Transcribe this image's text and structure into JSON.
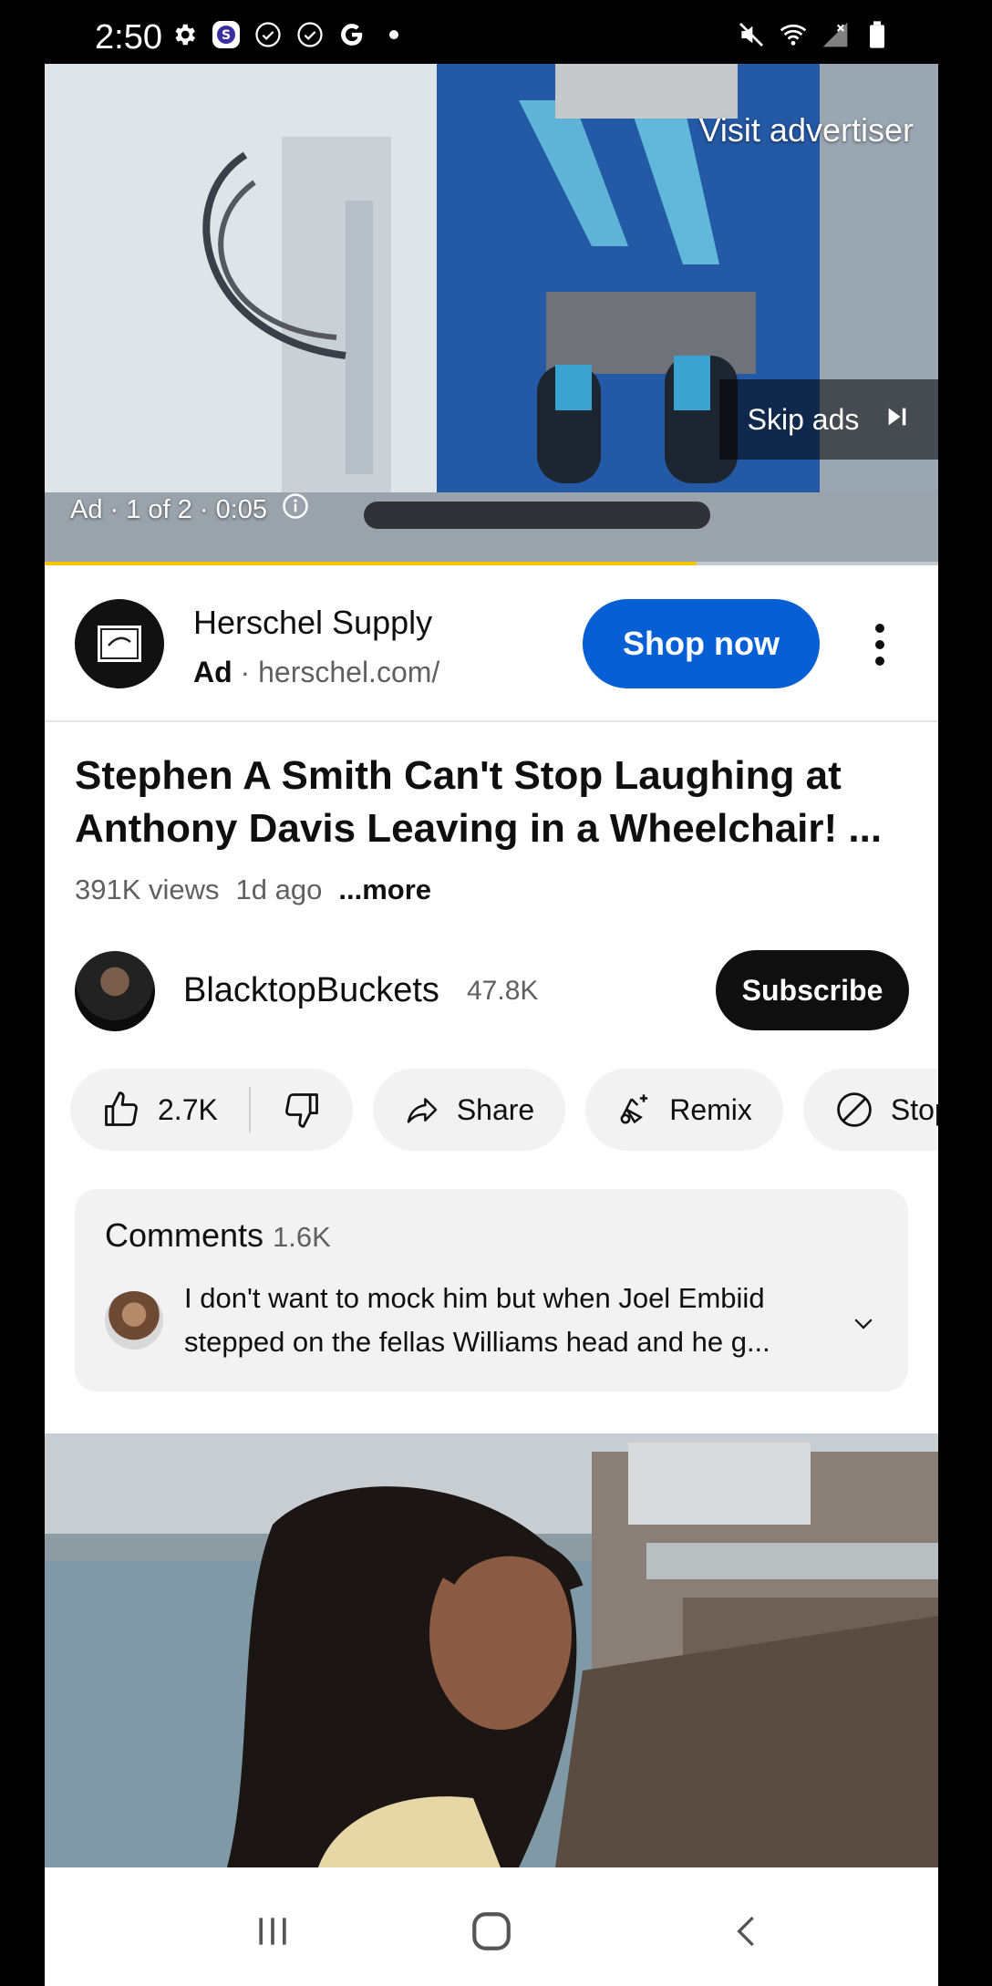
{
  "status_bar": {
    "time": "2:50",
    "left_icons": [
      "gear-icon",
      "app-s-icon",
      "check-circle-icon",
      "check-circle-icon",
      "google-g-icon",
      "dot-icon"
    ],
    "right_icons": [
      "mute-icon",
      "wifi-icon",
      "signal-icon",
      "battery-icon"
    ]
  },
  "ad_player": {
    "visit_advertiser": "Visit advertiser",
    "skip_ads": "Skip ads",
    "ad_counter": "Ad · 1 of 2 · 0:05",
    "progress_fraction": 0.73,
    "progress_color": "#f8c400"
  },
  "ad_bar": {
    "advertiser": "Herschel Supply",
    "ad_label": "Ad",
    "separator": "·",
    "url": "herschel.com/",
    "cta": "Shop now",
    "cta_color": "#065fd4"
  },
  "video": {
    "title": "Stephen A Smith Can't Stop Laughing at Anthony Davis Leaving in a Wheelchair! ...",
    "views": "391K views",
    "age": "1d ago",
    "more": "...more"
  },
  "channel": {
    "name": "BlacktopBuckets",
    "subscribers": "47.8K",
    "subscribe_label": "Subscribe"
  },
  "actions": {
    "like_count": "2.7K",
    "share": "Share",
    "remix": "Remix",
    "stop": "Stop"
  },
  "comments": {
    "title": "Comments",
    "count": "1.6K",
    "top_comment": "I don't want to mock him but when Joel Embiid stepped on the fellas Williams head and he g..."
  },
  "nav_bar": {
    "icons": [
      "recents-icon",
      "home-icon",
      "back-icon"
    ]
  }
}
